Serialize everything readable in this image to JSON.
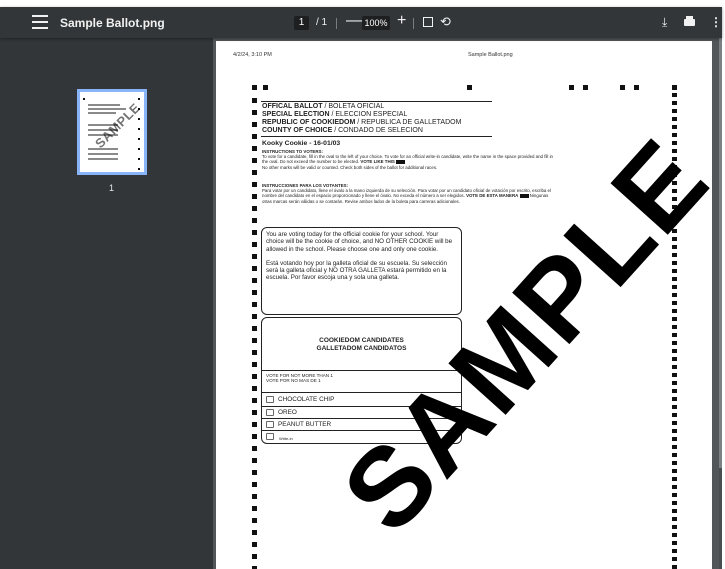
{
  "toolbar": {
    "title": "Sample Ballot.png",
    "current_page": "1",
    "page_separator": "/ 1",
    "zoom_out_label": "—",
    "zoom": "100%",
    "zoom_in_label": "+",
    "icons": [
      "menu-icon",
      "fit-page-icon",
      "rotate-icon",
      "download-icon",
      "print-icon",
      "more-options-icon"
    ]
  },
  "sidebar": {
    "thumbnail_watermark": "SAMPLE",
    "thumbnail_page_number": "1"
  },
  "page": {
    "header_date": "4/2/24, 3:10 PM",
    "header_file": "Sample Ballot.png",
    "ballot": {
      "title_lines": [
        {
          "bold": "OFFICAL BALLOT",
          "rest": " / BOLETA OFICIAL"
        },
        {
          "bold": "SPECIAL ELECTION",
          "rest": " / ELECCION ESPECIAL"
        },
        {
          "bold": "REPUBLIC OF COOKIEDOM",
          "rest": " / REPUBLICA DE GALLETADOM"
        },
        {
          "bold": "COUNTY OF CHOICE",
          "rest": " / CONDADO DE SELECION"
        }
      ],
      "election_name": "Kooky Cookie - 16-01/03",
      "instructions_en_title": "INSTRUCTIONS TO VOTERS:",
      "instructions_en_a": "To vote for a candidate, fill in the oval to the left of your choice. To vote for an official write-in candidate, write the name in the space provided and fill in the oval. Do not exceed the number to be elected.",
      "instructions_en_b": "VOTE LIKE THIS",
      "instructions_en_c": "No other marks will be valid or counted. Check both sides of the ballot for additional races.",
      "instructions_es_title": "INSTRUCCIONES PARA LOS VOTANTES:",
      "instructions_es_a": "Para votar por un candidato, llene el óvalo a la mano izquierda de su selección. Para votar por un candidato oficial de votación por escrito, escriba el nombre del candidato en el espacio proporcionado y llene el óvalo. No exceda el número a ser elegidos.",
      "instructions_es_b": "VOTE DE ESTA MANERA",
      "instructions_es_c": "Ningunas otras marcas serán válidas o se contarán. Revise ambos lados de la boleta para carreras adicionales.",
      "info_en": "You are voting today for the official cookie for your school. Your choice will be the cookie of choice, and NO OTHER COOKIE will be allowed in the school. Please choose one and only one cookie.",
      "info_es": "Está votando hoy por la galleta oficial de su escuela. Su selección será la galleta oficial y NO OTRA GALLETA estará permitido en la escuela. Por favor escoja una y sola una galleta.",
      "contest_title_en": "COOKIEDOM CANDIDATES",
      "contest_title_es": "GALLETADOM CANDIDATOS",
      "vote_for_en": "VOTE FOR NOT MORE THAN 1",
      "vote_for_es": "VOTE POR NO MAS DE 1",
      "options": [
        "CHOCOLATE CHIP",
        "OREO",
        "PEANUT BUTTER"
      ],
      "write_in_label": "Write-in",
      "watermark": "SAMPLE"
    }
  }
}
